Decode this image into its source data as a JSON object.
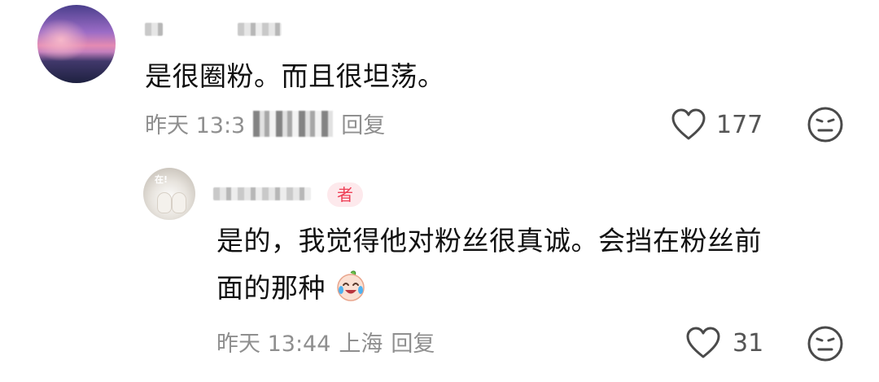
{
  "comment": {
    "text": "是很圈粉。而且很坦荡。",
    "time": "昨天 13:3",
    "reply_label": "回复",
    "like_count": "177"
  },
  "reply": {
    "author_badge": "者",
    "text_line1": "是的，我觉得他对粉丝很真诚。会挡在粉丝前",
    "text_line2": "面的那种",
    "time": "昨天 13:44",
    "location": "上海",
    "reply_label": "回复",
    "like_count": "31",
    "emoji": "crying-laughing-emoji"
  },
  "icons": {
    "like": "heart-outline-icon",
    "dislike": "neutral-face-icon"
  },
  "colors": {
    "meta": "#8f8f8f",
    "badge_text": "#ee3e55",
    "badge_bg": "#fde9ec"
  }
}
